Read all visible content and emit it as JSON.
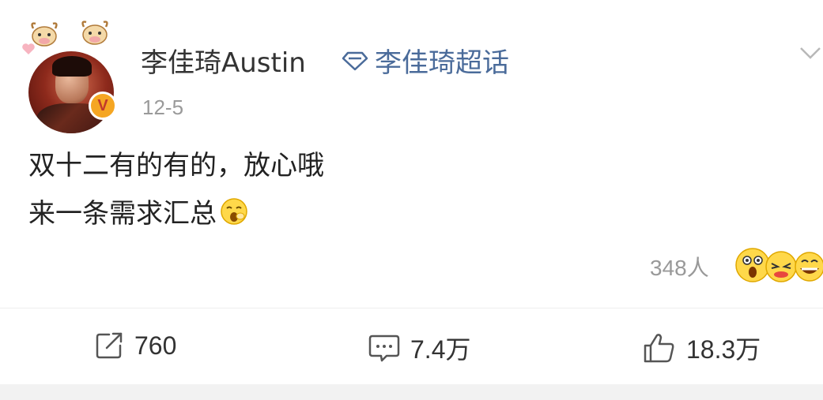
{
  "post": {
    "username": "李佳琦Austin",
    "supertopic": "李佳琦超话",
    "timestamp": "12-5",
    "verified_mark": "V",
    "content_line1": "双十二有的有的，放心哦",
    "content_line2": "来一条需求汇总",
    "reaction_count": "348人"
  },
  "actions": {
    "repost_count": "760",
    "comment_count": "7.4万",
    "like_count": "18.3万"
  },
  "icons": {
    "supertopic": "diamond-icon",
    "menu": "chevron-down-icon",
    "repost": "share-arrow-icon",
    "comment": "comment-bubble-icon",
    "like": "thumbs-up-icon"
  },
  "colors": {
    "accent_link": "#4a6b9a",
    "verify_badge": "#f5a623",
    "muted_text": "#999999"
  }
}
